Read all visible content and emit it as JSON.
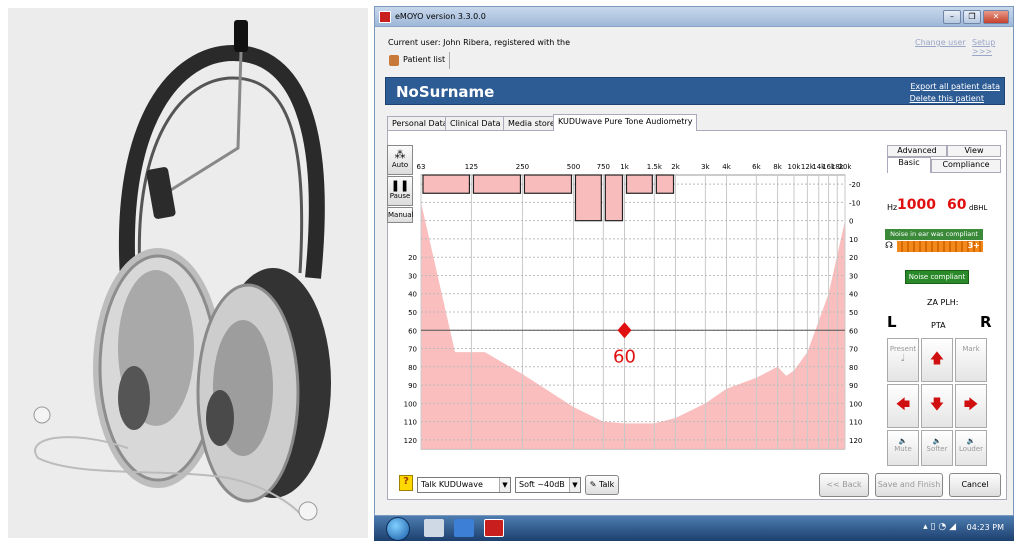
{
  "window": {
    "title": "eMOYO version 3.3.0.0"
  },
  "header": {
    "current_user": "Current user: John Ribera, registered with the",
    "change_user": "Change user",
    "setup": "Setup >>>",
    "patient_list": "Patient list"
  },
  "patient": {
    "name": "NoSurname",
    "export": "Export all patient data",
    "delete": "Delete this patient"
  },
  "tabs": [
    "Personal Data",
    "Clinical Data",
    "Media store",
    "KUDUwave Pure Tone Audiometry"
  ],
  "side_buttons": {
    "auto": "Auto",
    "pause": "Pause",
    "manual": "Manual"
  },
  "chart_data": {
    "type": "area",
    "x_tick_labels": [
      "63",
      "125",
      "250",
      "500",
      "750",
      "1k",
      "1.5k",
      "2k",
      "3k",
      "4k",
      "6k",
      "8k",
      "10k",
      "12k",
      "14k",
      "16k",
      "18k",
      "20k"
    ],
    "y_left_ticks": [
      "20",
      "30",
      "40",
      "50",
      "60",
      "70",
      "80",
      "90",
      "100",
      "110",
      "120"
    ],
    "y_right_ticks": [
      "-20",
      "-10",
      "0",
      "10",
      "20",
      "30",
      "40",
      "50",
      "60",
      "70",
      "80",
      "90",
      "100",
      "110",
      "120"
    ],
    "ylim": [
      -25,
      125
    ],
    "noise_bars_db": [
      {
        "from": "63",
        "to": "125",
        "level": -15
      },
      {
        "from": "125",
        "to": "250",
        "level": -15
      },
      {
        "from": "250",
        "to": "500",
        "level": -15
      },
      {
        "from": "500",
        "to": "750",
        "level": 0
      },
      {
        "from": "750",
        "to": "1k",
        "level": 0
      },
      {
        "from": "1k",
        "to": "1.5k",
        "level": -15
      },
      {
        "from": "1.5k",
        "to": "2k",
        "level": -15
      }
    ],
    "masking_curve_db": [
      [
        63,
        -10
      ],
      [
        100,
        72
      ],
      [
        150,
        72
      ],
      [
        250,
        84
      ],
      [
        500,
        102
      ],
      [
        750,
        110
      ],
      [
        1000,
        111
      ],
      [
        1500,
        111
      ],
      [
        2000,
        108
      ],
      [
        3000,
        100
      ],
      [
        4000,
        92
      ],
      [
        6000,
        86
      ],
      [
        8000,
        80
      ],
      [
        9000,
        85
      ],
      [
        10000,
        82
      ],
      [
        12000,
        72
      ],
      [
        16000,
        40
      ],
      [
        20000,
        0
      ]
    ],
    "marker": {
      "freq": "1k",
      "db": 60,
      "label": "60"
    },
    "grid": true,
    "colors": {
      "area": "#f9b7b7",
      "bar_fill": "#f9bcbc",
      "marker": "#e01010"
    }
  },
  "right_panel": {
    "tabs_top": [
      "Advanced",
      "View"
    ],
    "tabs_bottom": [
      "Basic",
      "Compliance"
    ],
    "hz_label": "Hz",
    "hz_value": "1000",
    "db_value": "60",
    "db_unit": "dBHL",
    "noise_ear": "Noise in ear was compliant",
    "noise_level": "3+",
    "noise_compliant": "Noise compliant",
    "za_plh": "ZA PLH:",
    "left": "L",
    "pta": "PTA",
    "right": "R",
    "present": "Present",
    "mark": "Mark",
    "mute": "Mute",
    "softer": "Softer",
    "louder": "Louder"
  },
  "bottom": {
    "talk_select": "Talk KUDUwave",
    "level_select": "Soft ~40dB",
    "talk": "Talk",
    "back": "<< Back",
    "save": "Save and Finish",
    "cancel": "Cancel"
  },
  "taskbar": {
    "time": "04:23 PM"
  }
}
